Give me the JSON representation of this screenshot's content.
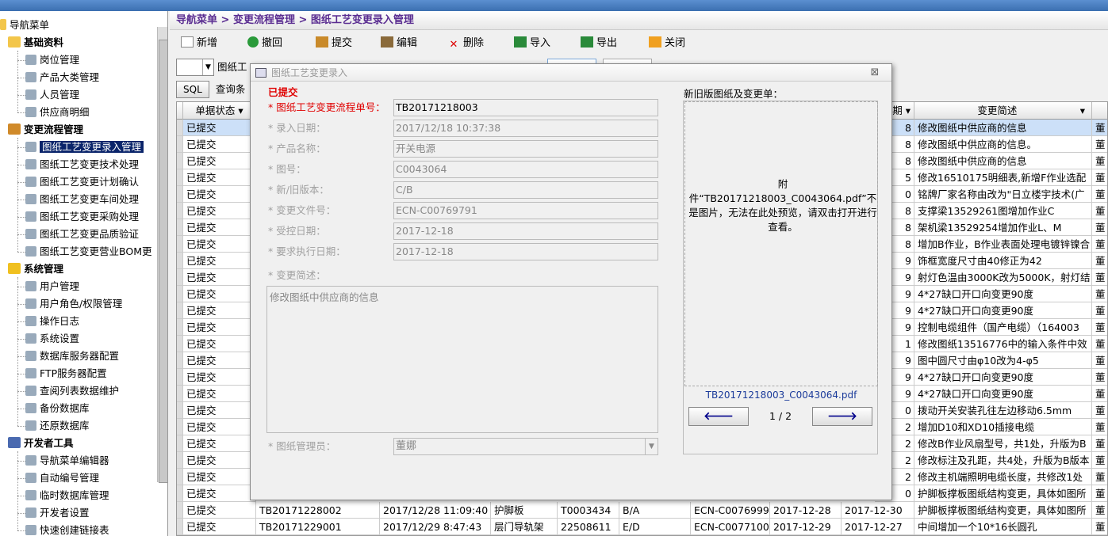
{
  "tree": {
    "root": "导航菜单",
    "groups": [
      {
        "label": "基础资料",
        "items": [
          "岗位管理",
          "产品大类管理",
          "人员管理",
          "供应商明细"
        ]
      },
      {
        "label": "变更流程管理",
        "items": [
          "图纸工艺变更录入管理",
          "图纸工艺变更技术处理",
          "图纸工艺变更计划确认",
          "图纸工艺变更车间处理",
          "图纸工艺变更采购处理",
          "图纸工艺变更品质验证",
          "图纸工艺变更营业BOM更"
        ]
      },
      {
        "label": "系统管理",
        "items": [
          "用户管理",
          "用户角色/权限管理",
          "操作日志",
          "系统设置",
          "数据库服务器配置",
          "FTP服务器配置",
          "查阅列表数据维护",
          "备份数据库",
          "还原数据库"
        ]
      },
      {
        "label": "开发者工具",
        "items": [
          "导航菜单编辑器",
          "自动编号管理",
          "临时数据库管理",
          "开发者设置",
          "快速创建链接表"
        ]
      }
    ]
  },
  "breadcrumb": "导航菜单 > 变更流程管理 > 图纸工艺变更录入管理",
  "toolbar": {
    "add": "新增",
    "undo": "撤回",
    "submit": "提交",
    "edit": "编辑",
    "delete": "删除",
    "import": "导入",
    "export": "导出",
    "close": "关闭"
  },
  "filter": {
    "field": "图纸工",
    "sql": "SQL",
    "query": "查询条"
  },
  "grid": {
    "headers": {
      "status": "单据状态",
      "date": "期",
      "desc": "变更简述"
    },
    "rows": [
      {
        "status": "已提交",
        "d": "8",
        "desc": "修改图纸中供应商的信息",
        "p": "董"
      },
      {
        "status": "已提交",
        "d": "8",
        "desc": "修改图纸中供应商的信息。",
        "p": "董"
      },
      {
        "status": "已提交",
        "d": "8",
        "desc": "修改图纸中供应商的信息",
        "p": "董"
      },
      {
        "status": "已提交",
        "d": "5",
        "desc": "修改16510175明细表,新增F作业选配",
        "p": "董"
      },
      {
        "status": "已提交",
        "d": "0",
        "desc": "铭牌厂家名称由改为\"日立楼宇技术(广",
        "p": "董"
      },
      {
        "status": "已提交",
        "d": "8",
        "desc": "支撑梁13529261图增加作业C",
        "p": "董"
      },
      {
        "status": "已提交",
        "d": "8",
        "desc": "架机梁13529254增加作业L、M",
        "p": "董"
      },
      {
        "status": "已提交",
        "d": "8",
        "desc": "增加B作业，B作业表面处理电镀锌镍合",
        "p": "董"
      },
      {
        "status": "已提交",
        "d": "9",
        "desc": "饰框宽度尺寸由40修正为42",
        "p": "董"
      },
      {
        "status": "已提交",
        "d": "9",
        "desc": "射灯色温由3000K改为5000K，射灯结",
        "p": "董"
      },
      {
        "status": "已提交",
        "d": "9",
        "desc": "4*27缺口开口向变更90度",
        "p": "董"
      },
      {
        "status": "已提交",
        "d": "9",
        "desc": "4*27缺口开口向变更90度",
        "p": "董"
      },
      {
        "status": "已提交",
        "d": "9",
        "desc": "控制电缆组件（国产电缆）（164003",
        "p": "董"
      },
      {
        "status": "已提交",
        "d": "1",
        "desc": "修改图纸13516776中的输入条件中效",
        "p": "董"
      },
      {
        "status": "已提交",
        "d": "9",
        "desc": "图中圆尺寸由φ10改为4-φ5",
        "p": "董"
      },
      {
        "status": "已提交",
        "d": "9",
        "desc": "4*27缺口开口向变更90度",
        "p": "董"
      },
      {
        "status": "已提交",
        "d": "9",
        "desc": "4*27缺口开口向变更90度",
        "p": "董"
      },
      {
        "status": "已提交",
        "d": "0",
        "desc": "拨动开关安装孔往左边移动6.5mm",
        "p": "董"
      },
      {
        "status": "已提交",
        "d": "2",
        "desc": "增加D10和XD10插接电缆",
        "p": "董"
      },
      {
        "status": "已提交",
        "d": "2",
        "desc": "修改B作业风扇型号，共1处，升版为B",
        "p": "董"
      },
      {
        "status": "已提交",
        "d": "2",
        "desc": "修改标注及孔距，共4处，升版为B版本",
        "p": "董"
      },
      {
        "status": "已提交",
        "d": "2",
        "desc": "修改主机端照明电缆长度，共修改1处",
        "p": "董"
      },
      {
        "status": "已提交",
        "d": "0",
        "desc": "护脚板撑板图纸结构变更，具体如图所",
        "p": "董"
      }
    ],
    "full_rows": [
      {
        "status": "已提交",
        "no": "TB20171228002",
        "time": "2017/12/28 11:09:40",
        "name": "护脚板",
        "code": "T0003434",
        "ver": "B/A",
        "ecn": "ECN-C0076999",
        "d1": "2017-12-28",
        "d2": "2017-12-30",
        "desc": "护脚板撑板图纸结构变更，具体如图所",
        "p": "董"
      },
      {
        "status": "已提交",
        "no": "TB20171229001",
        "time": "2017/12/29 8:47:43",
        "name": "层门导轨架",
        "code": "22508611",
        "ver": "E/D",
        "ecn": "ECN-C0077100",
        "d1": "2017-12-29",
        "d2": "2017-12-27",
        "desc": "中间增加一个10*16长圆孔",
        "p": "董"
      }
    ]
  },
  "modal": {
    "title": "图纸工艺变更录入",
    "close": "⊠",
    "status": "已提交",
    "fields": [
      {
        "label": "* 图纸工艺变更流程单号：",
        "value": "TB20171218003",
        "req": true
      },
      {
        "label": "* 录入日期：",
        "value": "2017/12/18 10:37:38"
      },
      {
        "label": "* 产品名称：",
        "value": "开关电源"
      },
      {
        "label": "* 图号：",
        "value": "C0043064"
      },
      {
        "label": "* 新/旧版本：",
        "value": "C/B"
      },
      {
        "label": "* 变更文件号：",
        "value": "ECN-C00769791"
      },
      {
        "label": "* 受控日期：",
        "value": "2017-12-18"
      },
      {
        "label": "* 要求执行日期：",
        "value": "2017-12-18"
      }
    ],
    "desc_label": "* 变更简述：",
    "desc_value": "修改图纸中供应商的信息",
    "manager_label": "* 图纸管理员：",
    "manager_value": "董娜",
    "attach_title": "新旧版图纸及变更单：",
    "attach_msg": "附件“TB20171218003_C0043064.pdf”不是图片，无法在此处预览，请双击打开进行查看。",
    "attach_name": "TB20171218003_C0043064.pdf",
    "prev": "🡐",
    "next": "🡒",
    "pager": "1 / 2"
  }
}
